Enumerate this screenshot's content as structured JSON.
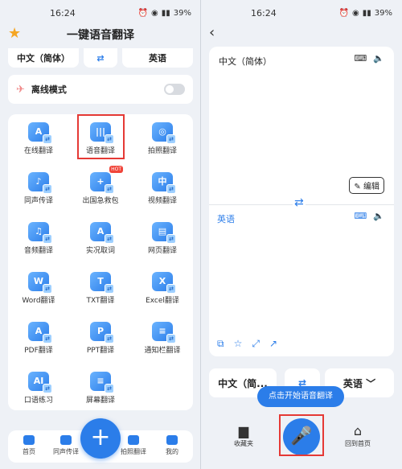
{
  "left": {
    "status": {
      "time": "16:24",
      "battery": "39%"
    },
    "title": "一键语音翻译",
    "source_lang": "中文（简体）",
    "target_lang": "英语",
    "offline_label": "离线模式",
    "tools": [
      {
        "label": "在线翻译",
        "icon": "A"
      },
      {
        "label": "语音翻译",
        "icon": "|||"
      },
      {
        "label": "拍照翻译",
        "icon": "◎"
      },
      {
        "label": "同声传译",
        "icon": "♪"
      },
      {
        "label": "出国急救包",
        "icon": "+",
        "badge": "HOT"
      },
      {
        "label": "视频翻译",
        "icon": "中"
      },
      {
        "label": "音频翻译",
        "icon": "♫"
      },
      {
        "label": "实况取词",
        "icon": "A"
      },
      {
        "label": "网页翻译",
        "icon": "▤"
      },
      {
        "label": "Word翻译",
        "icon": "W"
      },
      {
        "label": "TXT翻译",
        "icon": "T"
      },
      {
        "label": "Excel翻译",
        "icon": "X"
      },
      {
        "label": "PDF翻译",
        "icon": "A"
      },
      {
        "label": "PPT翻译",
        "icon": "P"
      },
      {
        "label": "通知栏翻译",
        "icon": "≡"
      },
      {
        "label": "口语练习",
        "icon": "AI"
      },
      {
        "label": "屏幕翻译",
        "icon": "≡"
      }
    ],
    "nav": [
      "首页",
      "同声传译",
      "拍照翻译",
      "我的"
    ],
    "fab": "+"
  },
  "right": {
    "status": {
      "time": "16:24",
      "battery": "39%"
    },
    "source_lang": "中文（简体）",
    "target_lang": "英语",
    "edit_label": "编辑",
    "bottom_source": "中文（简...",
    "bottom_target": "英语 ﹀",
    "tooltip": "点击开始语音翻译",
    "favorites": "收藏夹",
    "home": "回到首页"
  }
}
